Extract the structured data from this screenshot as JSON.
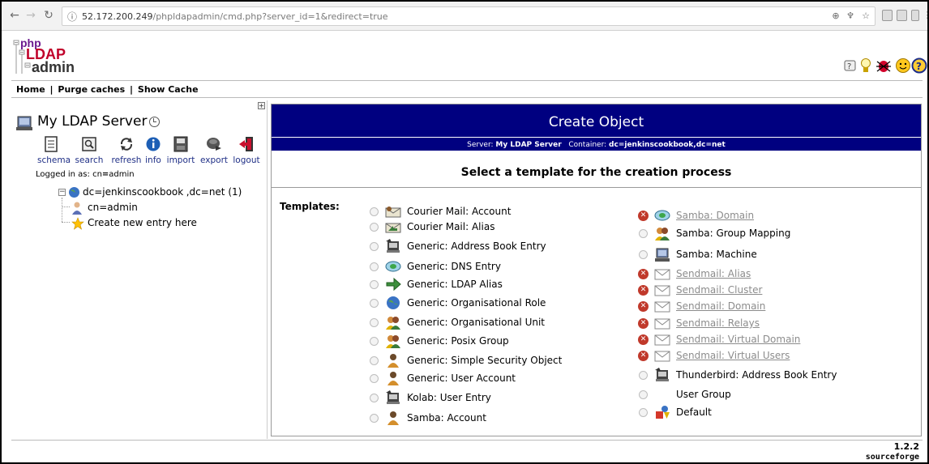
{
  "browser": {
    "url_host": "52.172.200.249",
    "url_rest": "/phpldapadmin/cmd.php?server_id=1&redirect=true"
  },
  "logo": {
    "line1": "php",
    "line2": "LDAP",
    "line3": "admin"
  },
  "menu": {
    "home": "Home",
    "purge": "Purge caches",
    "show_cache": "Show Cache",
    "sep": "|"
  },
  "sidebar": {
    "server_name": "My LDAP Server",
    "tools": [
      "schema",
      "search",
      "refresh",
      "info",
      "import",
      "export",
      "logout"
    ],
    "logged_in_label": "Logged in as: cn",
    "logged_in_eq": "=",
    "logged_in_value": "admin",
    "tree": {
      "root_dc1": "dc=jenkinscookbook",
      "root_sep": ",",
      "root_dc2": "dc=net",
      "root_count": "(1)",
      "child_label": "cn=admin",
      "create_label": "Create new entry here"
    }
  },
  "main": {
    "title": "Create Object",
    "server_label": "Server:",
    "server_value": "My LDAP Server",
    "container_label": "Container:",
    "container_value": "dc=jenkinscookbook,dc=net",
    "heading": "Select a template for the creation process",
    "templates_label": "Templates:",
    "templates_left": [
      {
        "label": "Courier Mail: Account",
        "icon": "mail-account-icon"
      },
      {
        "label": "Courier Mail: Alias",
        "icon": "mail-alias-icon"
      },
      {
        "label": "Generic: Address Book Entry",
        "icon": "address-book-icon"
      },
      {
        "label": "Generic: DNS Entry",
        "icon": "dns-icon"
      },
      {
        "label": "Generic: LDAP Alias",
        "icon": "arrow-icon"
      },
      {
        "label": "Generic: Organisational Role",
        "icon": "globe-icon"
      },
      {
        "label": "Generic: Organisational Unit",
        "icon": "ou-icon"
      },
      {
        "label": "Generic: Posix Group",
        "icon": "group-icon"
      },
      {
        "label": "Generic: Simple Security Object",
        "icon": "user-icon"
      },
      {
        "label": "Generic: User Account",
        "icon": "user-icon"
      },
      {
        "label": "Kolab: User Entry",
        "icon": "address-book-icon"
      },
      {
        "label": "Samba: Account",
        "icon": "user-icon"
      }
    ],
    "templates_right": [
      {
        "label": "Samba: Domain",
        "icon": "dns-icon",
        "disabled": true
      },
      {
        "label": "Samba: Group Mapping",
        "icon": "group-icon",
        "disabled": false
      },
      {
        "label": "Samba: Machine",
        "icon": "computer-icon",
        "disabled": false
      },
      {
        "label": "Sendmail: Alias",
        "icon": "envelope-icon",
        "disabled": true
      },
      {
        "label": "Sendmail: Cluster",
        "icon": "envelope-icon",
        "disabled": true
      },
      {
        "label": "Sendmail: Domain",
        "icon": "envelope-icon",
        "disabled": true
      },
      {
        "label": "Sendmail: Relays",
        "icon": "envelope-icon",
        "disabled": true
      },
      {
        "label": "Sendmail: Virtual Domain",
        "icon": "envelope-icon",
        "disabled": true
      },
      {
        "label": "Sendmail: Virtual Users",
        "icon": "envelope-icon",
        "disabled": true
      },
      {
        "label": "Thunderbird: Address Book Entry",
        "icon": "address-book-icon",
        "disabled": false
      },
      {
        "label": "User Group",
        "icon": "",
        "disabled": false
      },
      {
        "label": "Default",
        "icon": "objects-icon",
        "disabled": false
      }
    ]
  },
  "footer": {
    "version": "1.2.2",
    "sourceforge": "sourceforge"
  },
  "colors": {
    "title_bg": "#000080",
    "link": "#1f2f86",
    "disabled": "#8c8c8c",
    "error": "#c0392b"
  }
}
